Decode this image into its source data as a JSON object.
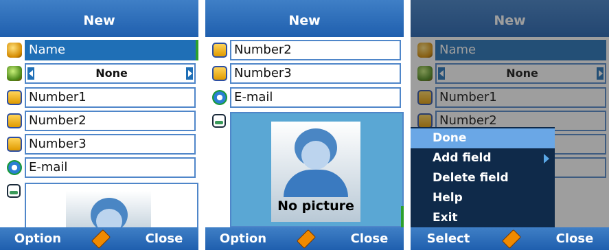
{
  "screen1": {
    "title": "New",
    "fields": {
      "name": "Name",
      "group": "None",
      "number1": "Number1",
      "number2": "Number2",
      "number3": "Number3",
      "email": "E-mail"
    },
    "softkeys": {
      "left": "Option",
      "right": "Close"
    }
  },
  "screen2": {
    "title": "New",
    "fields": {
      "number2": "Number2",
      "number3": "Number3",
      "email": "E-mail"
    },
    "picture_label": "No picture",
    "softkeys": {
      "left": "Option",
      "right": "Close"
    }
  },
  "screen3": {
    "title": "New",
    "fields": {
      "name": "Name",
      "group": "None",
      "number1": "Number1",
      "number2": "Number2"
    },
    "menu": [
      "Done",
      "Add field",
      "Delete field",
      "Help",
      "Exit"
    ],
    "softkeys": {
      "left": "Select",
      "right": "Close"
    }
  },
  "icons": [
    "name-icon",
    "group-icon",
    "phone-icon",
    "email-icon",
    "picture-icon",
    "pencil-icon",
    "arrow-left-icon",
    "arrow-right-icon"
  ],
  "colors": {
    "bar": "#2f6fb6",
    "field_border": "#4f86c9",
    "selection": "#1f6fb6",
    "menu_bg": "#0f2a4a",
    "menu_highlight": "#6aa7e6",
    "scrollbar": "#2ca02c"
  }
}
